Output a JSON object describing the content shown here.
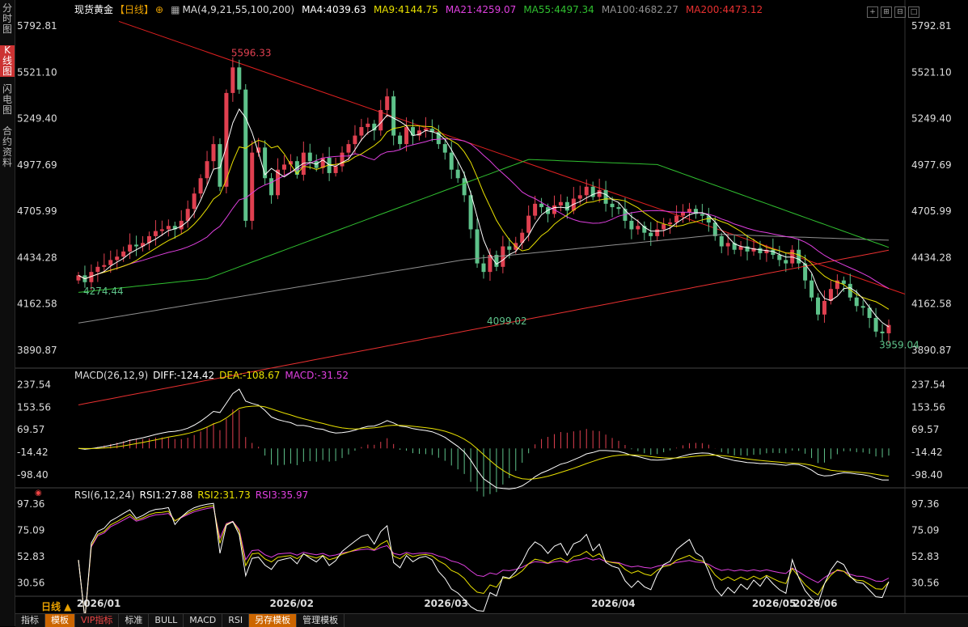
{
  "sidebar": {
    "tabs": [
      {
        "label": "分时图",
        "active": false
      },
      {
        "label": "K线图",
        "active": true
      },
      {
        "label": "闪电图",
        "active": false
      },
      {
        "label": "合约资料",
        "active": false
      }
    ]
  },
  "header": {
    "title": "现货黄金",
    "period": "【日线】",
    "ma_label": "MA(4,9,21,55,100,200)",
    "ma_items": [
      {
        "text": "MA4:4039.63",
        "color": "#ffffff"
      },
      {
        "text": "MA9:4144.75",
        "color": "#e8e000"
      },
      {
        "text": "MA21:4259.07",
        "color": "#e040e0"
      },
      {
        "text": "MA55:4497.34",
        "color": "#30c030"
      },
      {
        "text": "MA100:4682.27",
        "color": "#909090"
      },
      {
        "text": "MA200:4473.12",
        "color": "#e83030"
      }
    ]
  },
  "macd_legend": {
    "label": "MACD(26,12,9)",
    "items": [
      {
        "text": "DIFF:-124.42",
        "color": "#ffffff"
      },
      {
        "text": "DEA:-108.67",
        "color": "#e8e000"
      },
      {
        "text": "MACD:-31.52",
        "color": "#e040e0"
      }
    ]
  },
  "rsi_legend": {
    "label": "RSI(6,12,24)",
    "items": [
      {
        "text": "RSI1:27.88",
        "color": "#ffffff"
      },
      {
        "text": "RSI2:31.73",
        "color": "#e8e000"
      },
      {
        "text": "RSI3:35.97",
        "color": "#e040e0"
      }
    ]
  },
  "period_label": "日线 ▲",
  "toolbar": {
    "items": [
      {
        "label": "指标",
        "style": ""
      },
      {
        "label": "模板",
        "style": "hl"
      },
      {
        "label": "VIP指标",
        "style": "red"
      },
      {
        "label": "标准",
        "style": ""
      },
      {
        "label": "BULL",
        "style": ""
      },
      {
        "label": "MACD",
        "style": ""
      },
      {
        "label": "RSI",
        "style": ""
      },
      {
        "label": "另存模板",
        "style": "hl"
      },
      {
        "label": "管理模板",
        "style": ""
      }
    ]
  },
  "colors": {
    "up": "#e04050",
    "down": "#5ec28a",
    "trendline": "#e02020"
  },
  "chart_data": [
    {
      "type": "candlestick",
      "title": "现货黄金【日线】",
      "x_ticks": [
        "2026/01",
        "2026/02",
        "2026/03",
        "2026/04",
        "2026/05",
        "2026/06"
      ],
      "y_ticks": [
        5792.81,
        5521.1,
        5249.4,
        4977.69,
        4705.99,
        4434.28,
        4162.58,
        3890.87
      ],
      "ylim": [
        3800,
        5860
      ],
      "annotations": [
        {
          "text": "5596.33",
          "kind": "high"
        },
        {
          "text": "4274.44",
          "kind": "low"
        },
        {
          "text": "4099.02",
          "kind": "low"
        },
        {
          "text": "3959.04",
          "kind": "low"
        }
      ],
      "close": [
        4330,
        4290,
        4350,
        4380,
        4390,
        4420,
        4440,
        4470,
        4510,
        4500,
        4520,
        4560,
        4590,
        4600,
        4620,
        4600,
        4650,
        4720,
        4810,
        4900,
        5000,
        5100,
        4850,
        5400,
        5550,
        5420,
        4650,
        5050,
        5080,
        4900,
        4800,
        4950,
        4980,
        5000,
        4920,
        5050,
        5000,
        4960,
        5020,
        4930,
        4970,
        5050,
        5100,
        5150,
        5200,
        5220,
        5180,
        5300,
        5380,
        5150,
        5100,
        5200,
        5150,
        5180,
        5190,
        5170,
        5100,
        5050,
        4950,
        4900,
        4800,
        4600,
        4400,
        4350,
        4450,
        4380,
        4500,
        4480,
        4520,
        4580,
        4680,
        4750,
        4730,
        4690,
        4740,
        4760,
        4710,
        4780,
        4800,
        4850,
        4790,
        4830,
        4750,
        4730,
        4720,
        4650,
        4600,
        4620,
        4580,
        4560,
        4600,
        4630,
        4640,
        4680,
        4700,
        4720,
        4690,
        4680,
        4640,
        4560,
        4500,
        4520,
        4480,
        4500,
        4470,
        4490,
        4460,
        4480,
        4450,
        4420,
        4400,
        4480,
        4400,
        4300,
        4200,
        4100,
        4180,
        4250,
        4300,
        4280,
        4200,
        4150,
        4140,
        4080,
        4000,
        3990,
        4039
      ],
      "series": [
        {
          "name": "MA4",
          "color": "#ffffff"
        },
        {
          "name": "MA9",
          "color": "#e8e000"
        },
        {
          "name": "MA21",
          "color": "#e040e0"
        },
        {
          "name": "MA55",
          "color": "#30c030"
        },
        {
          "name": "MA100",
          "color": "#909090"
        },
        {
          "name": "MA200",
          "color": "#e83030"
        }
      ]
    },
    {
      "type": "bar+line",
      "title": "MACD(26,12,9)",
      "y_ticks": [
        237.54,
        153.56,
        69.57,
        -14.42,
        -98.4
      ],
      "ylim": [
        -150,
        260
      ],
      "series": [
        {
          "name": "DIFF",
          "color": "#ffffff"
        },
        {
          "name": "DEA",
          "color": "#e8e000"
        },
        {
          "name": "MACD",
          "color": "#e040e0"
        }
      ]
    },
    {
      "type": "line",
      "title": "RSI(6,12,24)",
      "y_ticks": [
        97.36,
        75.09,
        52.83,
        30.56
      ],
      "ylim": [
        20,
        102
      ],
      "series": [
        {
          "name": "RSI1",
          "color": "#ffffff"
        },
        {
          "name": "RSI2",
          "color": "#e8e000"
        },
        {
          "name": "RSI3",
          "color": "#e040e0"
        }
      ]
    }
  ]
}
